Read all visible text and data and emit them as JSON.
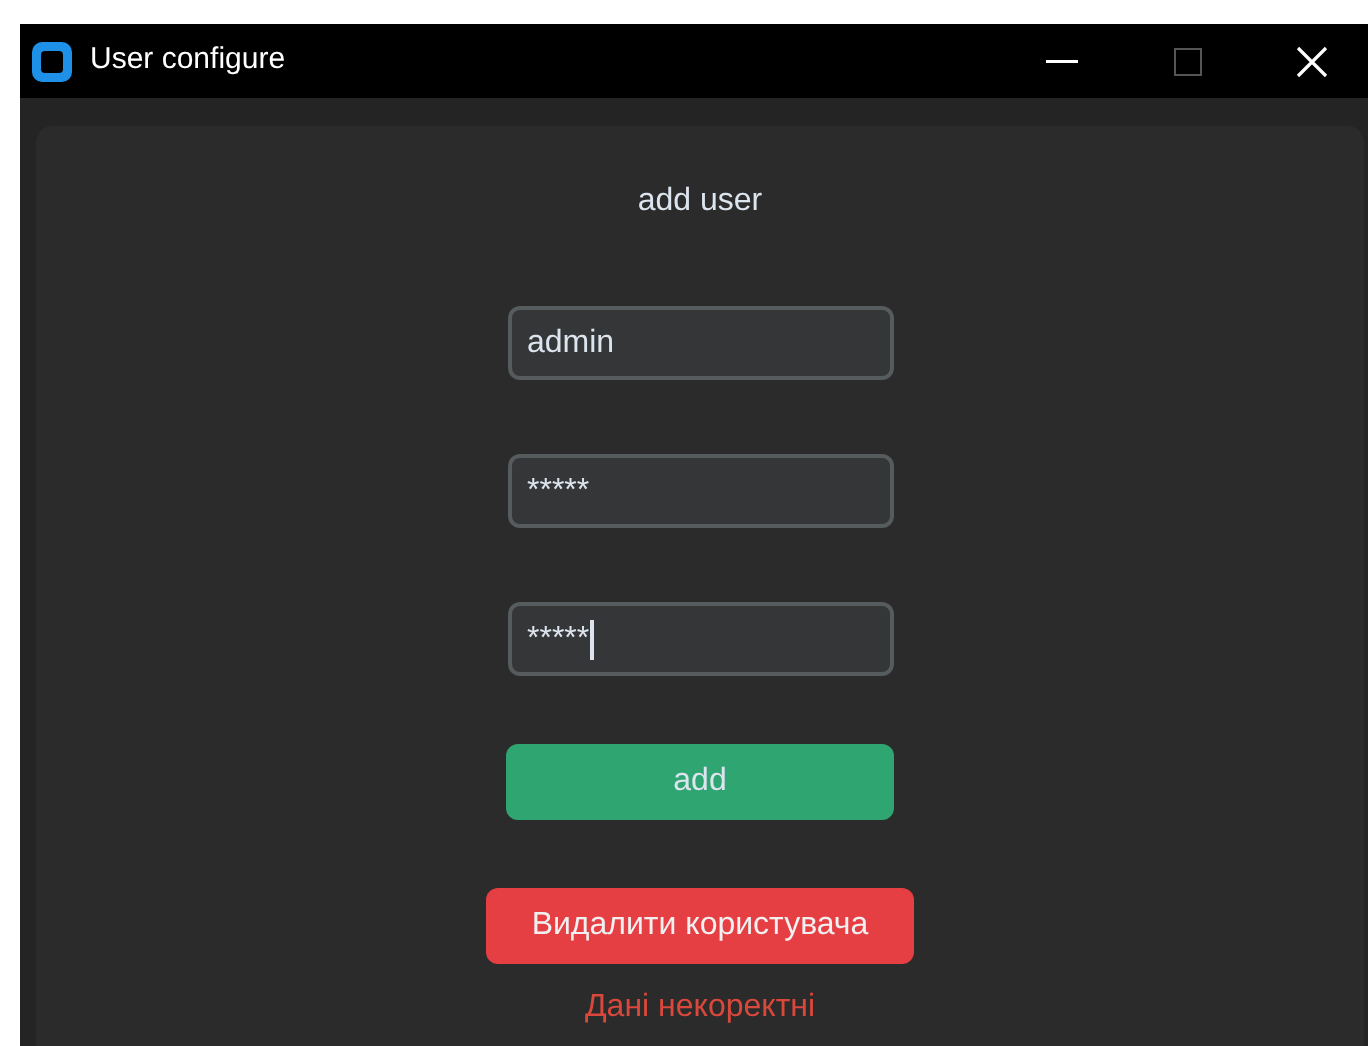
{
  "window": {
    "title": "User configure"
  },
  "heading": "add user",
  "fields": [
    {
      "value": "admin",
      "focused": false
    },
    {
      "value": "*****",
      "focused": false
    },
    {
      "value": "*****",
      "focused": true
    }
  ],
  "add_button": "add",
  "delete_button": "Видалити користувача",
  "error": "Дані некоректні"
}
